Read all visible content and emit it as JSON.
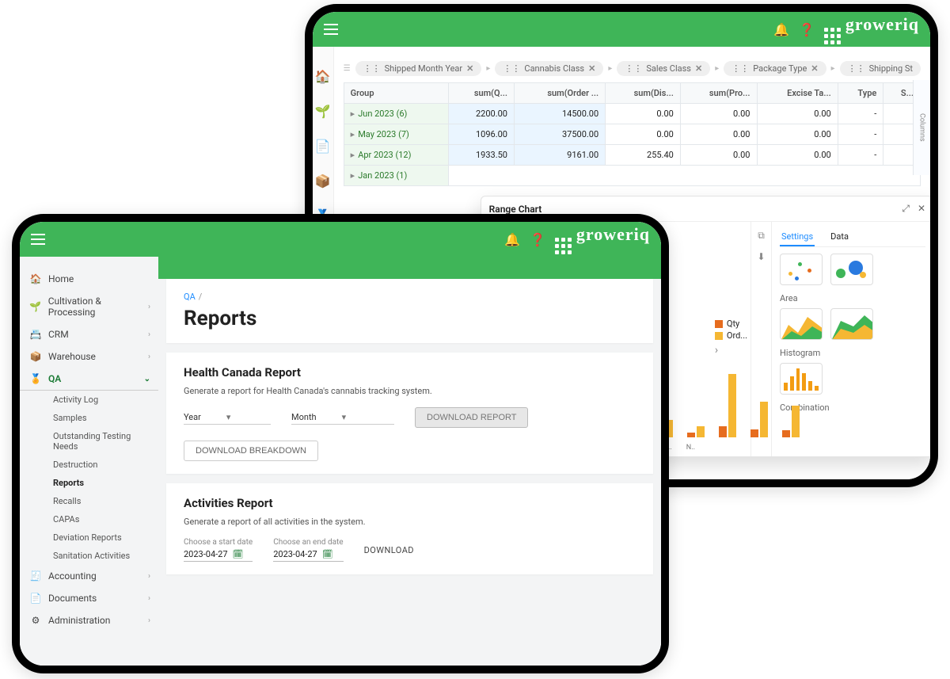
{
  "brand": "groweriq",
  "back": {
    "chips": [
      "Shipped Month Year",
      "Cannabis Class",
      "Sales Class",
      "Package Type",
      "Shipping St"
    ],
    "columns": [
      "Group",
      "sum(Q...",
      "sum(Order ...",
      "sum(Dis...",
      "sum(Pro...",
      "Excise Ta...",
      "Type",
      "S..."
    ],
    "rows": [
      {
        "label": "Jun 2023 (6)",
        "q": "2200.00",
        "ord": "14500.00",
        "dis": "0.00",
        "pro": "0.00",
        "tax": "0.00",
        "type": "-"
      },
      {
        "label": "May 2023 (7)",
        "q": "1096.00",
        "ord": "37500.00",
        "dis": "0.00",
        "pro": "0.00",
        "tax": "0.00",
        "type": "-"
      },
      {
        "label": "Apr 2023 (12)",
        "q": "1933.50",
        "ord": "9161.00",
        "dis": "255.40",
        "pro": "0.00",
        "tax": "0.00",
        "type": "-"
      },
      {
        "label": "Jan 2023 (1)",
        "q": "",
        "ord": "",
        "dis": "",
        "pro": "",
        "tax": "",
        "type": ""
      }
    ],
    "sideLabel": "Columns",
    "panel": {
      "title": "Range Chart",
      "actions": {
        "expand": "⤢",
        "close": "✕"
      },
      "tool": {
        "link": "⧉",
        "download": "⬇"
      },
      "tabs": {
        "settings": "Settings",
        "data": "Data"
      },
      "sections": {
        "area": "Area",
        "hist": "Histogram",
        "combo": "Combination"
      },
      "legend": {
        "qty": "Qty",
        "ord": "Ord..."
      },
      "xlabels": [
        "",
        "",
        "",
        "",
        "",
        "",
        "",
        "",
        "",
        "O..",
        "N..",
        ""
      ]
    }
  },
  "front": {
    "nav": {
      "home": "Home",
      "cult": "Cultivation & Processing",
      "crm": "CRM",
      "wh": "Warehouse",
      "qa": "QA",
      "sub": {
        "act": "Activity Log",
        "samp": "Samples",
        "out": "Outstanding Testing Needs",
        "dest": "Destruction",
        "rep": "Reports",
        "rec": "Recalls",
        "capa": "CAPAs",
        "dev": "Deviation Reports",
        "san": "Sanitation Activities"
      },
      "acc": "Accounting",
      "docs": "Documents",
      "admin": "Administration"
    },
    "crumb": {
      "root": "QA",
      "sep": "/"
    },
    "title": "Reports",
    "hc": {
      "title": "Health Canada Report",
      "desc": "Generate a report for Health Canada's cannabis tracking system.",
      "year": "Year",
      "month": "Month",
      "btnDL": "DOWNLOAD REPORT",
      "btnBD": "DOWNLOAD BREAKDOWN"
    },
    "ar": {
      "title": "Activities Report",
      "desc": "Generate a report of all activities in the system.",
      "startLbl": "Choose a start date",
      "endLbl": "Choose an end date",
      "start": "2023-04-27",
      "end": "2023-04-27",
      "dl": "DOWNLOAD"
    }
  }
}
